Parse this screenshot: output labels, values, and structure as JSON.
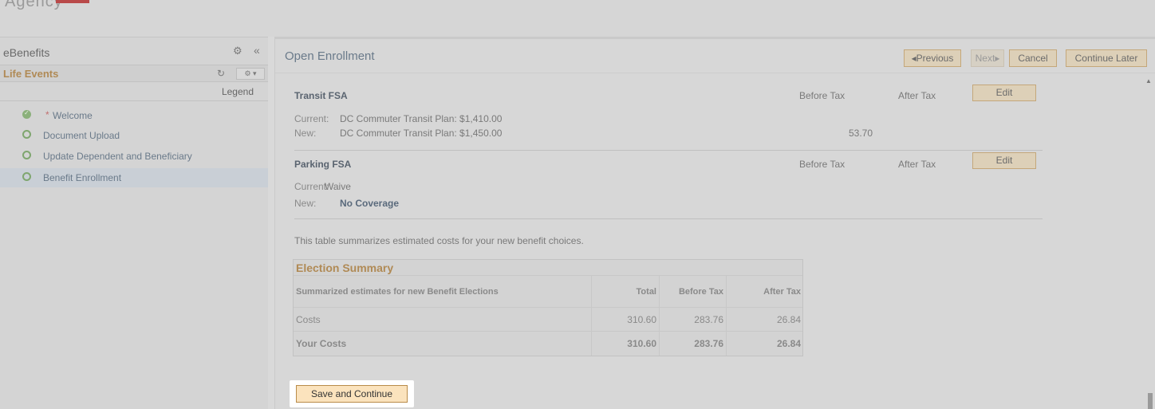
{
  "app": {
    "logo_text": "Agency"
  },
  "sidebar": {
    "title": "eBenefits",
    "section": "Life Events",
    "legend": "Legend",
    "items": [
      {
        "label": "Welcome",
        "required": "*",
        "status": "complete"
      },
      {
        "label": "Document Upload",
        "status": "open"
      },
      {
        "label": "Update Dependent and Beneficiary",
        "status": "open"
      },
      {
        "label": "Benefit Enrollment",
        "status": "open",
        "active": true
      }
    ]
  },
  "header": {
    "title": "Open Enrollment",
    "buttons": {
      "previous": "◂Previous",
      "next": "Next▸",
      "cancel": "Cancel",
      "continue_later": "Continue Later"
    }
  },
  "plans": [
    {
      "name": "Transit FSA",
      "before_tax_label": "Before Tax",
      "after_tax_label": "After Tax",
      "edit_label": "Edit",
      "current_label": "Current:",
      "current_value": "DC Commuter Transit Plan: $1,410.00",
      "new_label": "New:",
      "new_value": "DC Commuter Transit Plan: $1,450.00",
      "new_before_tax": "53.70"
    },
    {
      "name": "Parking FSA",
      "before_tax_label": "Before Tax",
      "after_tax_label": "After Tax",
      "edit_label": "Edit",
      "current_label": "Current:",
      "current_value": "Waive",
      "new_label": "New:",
      "new_value": "No Coverage"
    }
  ],
  "summary_note": "This table summarizes estimated costs for your new benefit choices.",
  "election_summary": {
    "title": "Election Summary",
    "columns": [
      "Summarized estimates for new Benefit Elections",
      "Total",
      "Before Tax",
      "After Tax"
    ],
    "rows": [
      [
        "Costs",
        "310.60",
        "283.76",
        "26.84"
      ],
      [
        "Your Costs",
        "310.60",
        "283.76",
        "26.84"
      ]
    ]
  },
  "actions": {
    "save_continue": "Save and Continue"
  },
  "colors": {
    "accent_gold": "#b08a55",
    "button_fill": "#fbe3bd",
    "complete_green": "#8bb07b"
  }
}
